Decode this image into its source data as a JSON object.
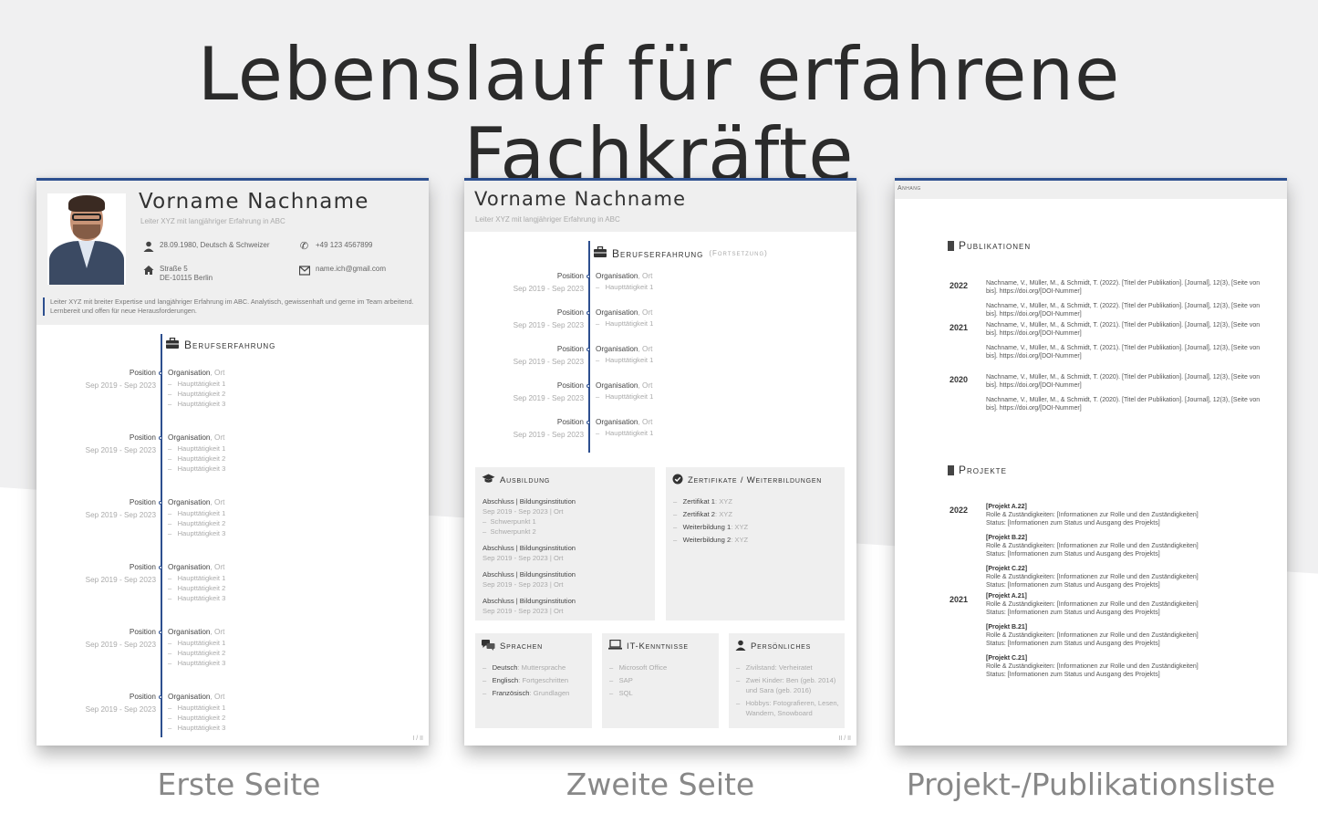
{
  "title": "Lebenslauf für erfahrene Fachkräfte",
  "captions": [
    "Erste Seite",
    "Zweite Seite",
    "Projekt-/Publikationsliste"
  ],
  "page1": {
    "name": "Vorname Nachname",
    "subtitle": "Leiter XYZ mit langjähriger Erfahrung in ABC",
    "birth": "28.09.1980, Deutsch & Schweizer",
    "phone": "+49 123 4567899",
    "street": "Straße 5",
    "city": "DE-10115 Berlin",
    "email": "name.ich@gmail.com",
    "intro": "Leiter XYZ mit breiter Expertise und langjähriger Erfahrung im ABC. Analytisch, gewissenhaft und gerne im Team arbeitend. Lernbereit und offen für neue Herausforderungen.",
    "section": "Berufserfahrung",
    "entries": [
      {
        "position": "Position",
        "date": "Sep 2019 - Sep 2023",
        "org": "Organisation",
        "ort": ", Ort",
        "tasks": [
          "Haupttätigkeit 1",
          "Haupttätigkeit 2",
          "Haupttätigkeit 3"
        ]
      },
      {
        "position": "Position",
        "date": "Sep 2019 - Sep 2023",
        "org": "Organisation",
        "ort": ", Ort",
        "tasks": [
          "Haupttätigkeit 1",
          "Haupttätigkeit 2",
          "Haupttätigkeit 3"
        ]
      },
      {
        "position": "Position",
        "date": "Sep 2019 - Sep 2023",
        "org": "Organisation",
        "ort": ", Ort",
        "tasks": [
          "Haupttätigkeit 1",
          "Haupttätigkeit 2",
          "Haupttätigkeit 3"
        ]
      },
      {
        "position": "Position",
        "date": "Sep 2019 - Sep 2023",
        "org": "Organisation",
        "ort": ", Ort",
        "tasks": [
          "Haupttätigkeit 1",
          "Haupttätigkeit 2",
          "Haupttätigkeit 3"
        ]
      },
      {
        "position": "Position",
        "date": "Sep 2019 - Sep 2023",
        "org": "Organisation",
        "ort": ", Ort",
        "tasks": [
          "Haupttätigkeit 1",
          "Haupttätigkeit 2",
          "Haupttätigkeit 3"
        ]
      },
      {
        "position": "Position",
        "date": "Sep 2019 - Sep 2023",
        "org": "Organisation",
        "ort": ", Ort",
        "tasks": [
          "Haupttätigkeit 1",
          "Haupttätigkeit 2",
          "Haupttätigkeit 3"
        ]
      }
    ],
    "page_number": "I / II"
  },
  "page2": {
    "name": "Vorname Nachname",
    "subtitle": "Leiter XYZ mit langjähriger Erfahrung in ABC",
    "section": "Berufserfahrung",
    "section_suffix": "(Fortsetzung)",
    "entries": [
      {
        "position": "Position",
        "date": "Sep 2019 - Sep 2023",
        "org": "Organisation",
        "ort": ", Ort",
        "task": "Haupttätigkeit 1"
      },
      {
        "position": "Position",
        "date": "Sep 2019 - Sep 2023",
        "org": "Organisation",
        "ort": ", Ort",
        "task": "Haupttätigkeit 1"
      },
      {
        "position": "Position",
        "date": "Sep 2019 - Sep 2023",
        "org": "Organisation",
        "ort": ", Ort",
        "task": "Haupttätigkeit 1"
      },
      {
        "position": "Position",
        "date": "Sep 2019 - Sep 2023",
        "org": "Organisation",
        "ort": ", Ort",
        "task": "Haupttätigkeit 1"
      },
      {
        "position": "Position",
        "date": "Sep 2019 - Sep 2023",
        "org": "Organisation",
        "ort": ", Ort",
        "task": "Haupttätigkeit 1"
      }
    ],
    "ausbildung": {
      "title": "Ausbildung",
      "entries": [
        {
          "head": "Abschluss | Bildungsinstitution",
          "sub": "Sep 2019 - Sep 2023 | Ort",
          "points": [
            "Schwerpunkt 1",
            "Schwerpunkt 2"
          ]
        },
        {
          "head": "Abschluss | Bildungsinstitution",
          "sub": "Sep 2019 - Sep 2023 | Ort",
          "points": []
        },
        {
          "head": "Abschluss | Bildungsinstitution",
          "sub": "Sep 2019 - Sep 2023 | Ort",
          "points": []
        },
        {
          "head": "Abschluss | Bildungsinstitution",
          "sub": "Sep 2019 - Sep 2023 | Ort",
          "points": []
        }
      ]
    },
    "zertifikate": {
      "title": "Zertifikate / Weiterbildungen",
      "items": [
        {
          "label": "Zertifikat 1",
          "val": ": XYZ"
        },
        {
          "label": "Zertifikat 2",
          "val": ": XYZ"
        },
        {
          "label": "Weiterbildung 1",
          "val": ": XYZ"
        },
        {
          "label": "Weiterbildung 2",
          "val": ": XYZ"
        }
      ]
    },
    "sprachen": {
      "title": "Sprachen",
      "items": [
        {
          "label": "Deutsch",
          "val": ": Muttersprache"
        },
        {
          "label": "Englisch",
          "val": ": Fortgeschritten"
        },
        {
          "label": "Französisch",
          "val": ": Grundlagen"
        }
      ]
    },
    "it": {
      "title": "IT-Kenntnisse",
      "items": [
        "Microsoft Office",
        "SAP",
        "SQL"
      ]
    },
    "persoenliches": {
      "title": "Persönliches",
      "items": [
        "Zivilstand: Verheiratet",
        "Zwei Kinder: Ben (geb. 2014) und Sara (geb. 2016)",
        "Hobbys: Fotografieren, Lesen, Wandern, Snowboard"
      ]
    },
    "page_number": "II / II"
  },
  "page3": {
    "header": "Anhang",
    "pub_title": "Publikationen",
    "publications": [
      {
        "year": "2022",
        "items": [
          "Nachname, V., Müller, M., & Schmidt, T. (2022). [Titel der Publikation]. [Journal], 12(3), [Seite von bis]. https://doi.org/[DOI-Nummer]",
          "Nachname, V., Müller, M., & Schmidt, T. (2022). [Titel der Publikation]. [Journal], 12(3), [Seite von bis]. https://doi.org/[DOI-Nummer]"
        ]
      },
      {
        "year": "2021",
        "items": [
          "Nachname, V., Müller, M., & Schmidt, T. (2021). [Titel der Publikation]. [Journal], 12(3), [Seite von bis]. https://doi.org/[DOI-Nummer]",
          "Nachname, V., Müller, M., & Schmidt, T. (2021). [Titel der Publikation]. [Journal], 12(3), [Seite von bis]. https://doi.org/[DOI-Nummer]"
        ]
      },
      {
        "year": "2020",
        "items": [
          "Nachname, V., Müller, M., & Schmidt, T. (2020). [Titel der Publikation]. [Journal], 12(3), [Seite von bis]. https://doi.org/[DOI-Nummer]",
          "Nachname, V., Müller, M., & Schmidt, T. (2020). [Titel der Publikation]. [Journal], 12(3), [Seite von bis]. https://doi.org/[DOI-Nummer]"
        ]
      }
    ],
    "proj_title": "Projekte",
    "projects": [
      {
        "year": "2022",
        "items": [
          {
            "name": "[Projekt A.22]",
            "role": "Rolle & Zuständigkeiten: [Informationen zur Rolle und den Zuständigkeiten]",
            "status": "Status: [Informationen zum Status und Ausgang des Projekts]"
          },
          {
            "name": "[Projekt B.22]",
            "role": "Rolle & Zuständigkeiten: [Informationen zur Rolle und den Zuständigkeiten]",
            "status": "Status: [Informationen zum Status und Ausgang des Projekts]"
          },
          {
            "name": "[Projekt C.22]",
            "role": "Rolle & Zuständigkeiten: [Informationen zur Rolle und den Zuständigkeiten]",
            "status": "Status: [Informationen zum Status und Ausgang des Projekts]"
          }
        ]
      },
      {
        "year": "2021",
        "items": [
          {
            "name": "[Projekt A.21]",
            "role": "Rolle & Zuständigkeiten: [Informationen zur Rolle und den Zuständigkeiten]",
            "status": "Status: [Informationen zum Status und Ausgang des Projekts]"
          },
          {
            "name": "[Projekt B.21]",
            "role": "Rolle & Zuständigkeiten: [Informationen zur Rolle und den Zuständigkeiten]",
            "status": "Status: [Informationen zum Status und Ausgang des Projekts]"
          },
          {
            "name": "[Projekt C.21]",
            "role": "Rolle & Zuständigkeiten: [Informationen zur Rolle und den Zuständigkeiten]",
            "status": "Status: [Informationen zum Status und Ausgang des Projekts]"
          }
        ]
      }
    ]
  },
  "colors": {
    "accent": "#2d4f8f",
    "header_bg": "#efefef",
    "muted": "#aaaaaa"
  }
}
